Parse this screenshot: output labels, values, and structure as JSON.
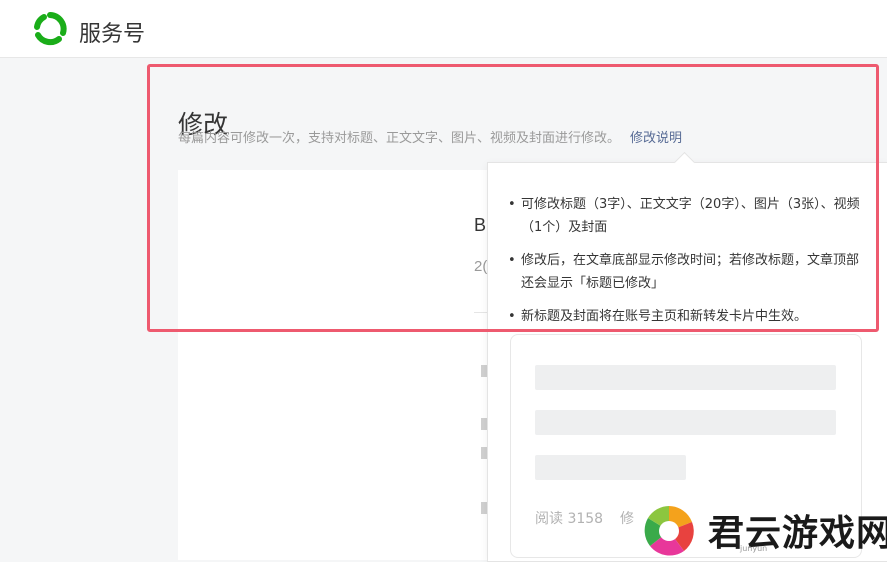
{
  "header": {
    "brand_name": "服务号",
    "logo_icon": "wechat-service-logo-icon",
    "accent_color": "#1aad19"
  },
  "section": {
    "title": "修改",
    "description": "每篇内容可修改一次，支持对标题、正文文字、图片、视频及封面进行修改。",
    "link_label": "修改说明"
  },
  "article_preview": {
    "title_char": "B",
    "date_char": "2("
  },
  "popover": {
    "tips": [
      "可修改标题（3字）、正文文字（20字）、图片（3张）、视频（1个）及封面",
      "修改后，在文章底部显示修改时间；若修改标题，文章顶部还会显示「标题已修改」",
      "新标题及封面将在账号主页和新转发卡片中生效。"
    ],
    "card": {
      "read_count": "阅读 3158",
      "edit_fragment": "修"
    }
  },
  "highlight_color": "#ee5a6f",
  "watermark": {
    "text": "君云游戏网",
    "sub": "junyun"
  }
}
